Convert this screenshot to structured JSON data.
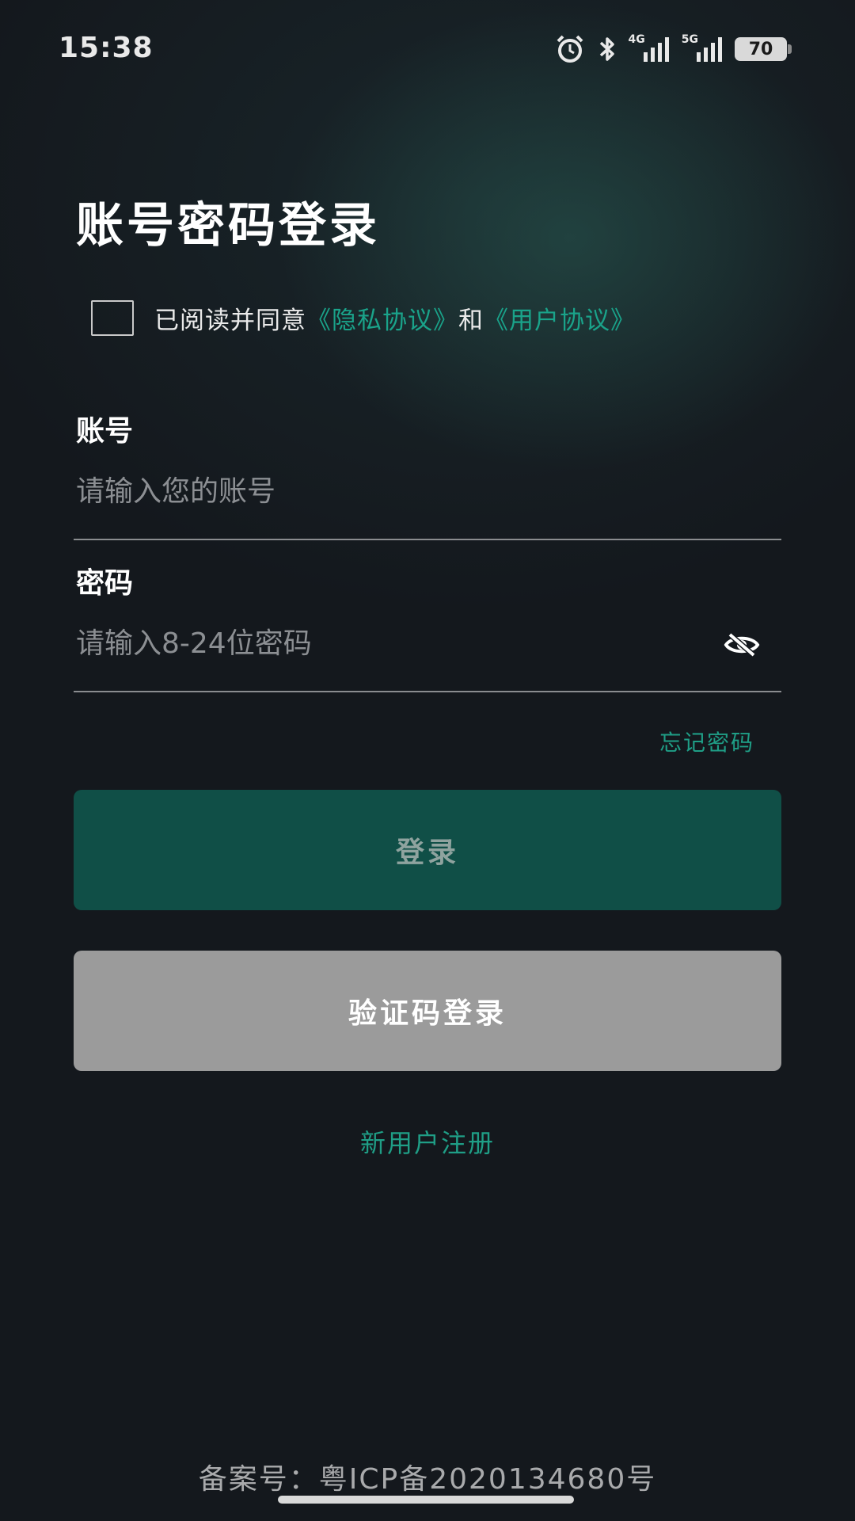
{
  "status_bar": {
    "time": "15:38",
    "net1": "4G",
    "net2": "5G",
    "battery": "70",
    "icons": [
      "alarm-icon",
      "bluetooth-icon",
      "signal-icon",
      "signal-icon",
      "battery-icon"
    ]
  },
  "title": "账号密码登录",
  "agreement": {
    "prefix": "已阅读并同意",
    "privacy_link": "《隐私协议》",
    "and": "和",
    "user_link": "《用户协议》",
    "checked": false
  },
  "account": {
    "label": "账号",
    "placeholder": "请输入您的账号",
    "value": ""
  },
  "password": {
    "label": "密码",
    "placeholder": "请输入8-24位密码",
    "value": "",
    "toggle_icon": "eye-off-icon"
  },
  "forgot_password": "忘记密码",
  "login_button": "登录",
  "sms_login_button": "验证码登录",
  "register_link": "新用户注册",
  "icp": "备案号：粤ICP备2020134680号",
  "colors": {
    "accent": "#1f9e86",
    "login_bg": "#104f47",
    "sms_bg": "#9b9b9b",
    "background": "#14181d"
  }
}
